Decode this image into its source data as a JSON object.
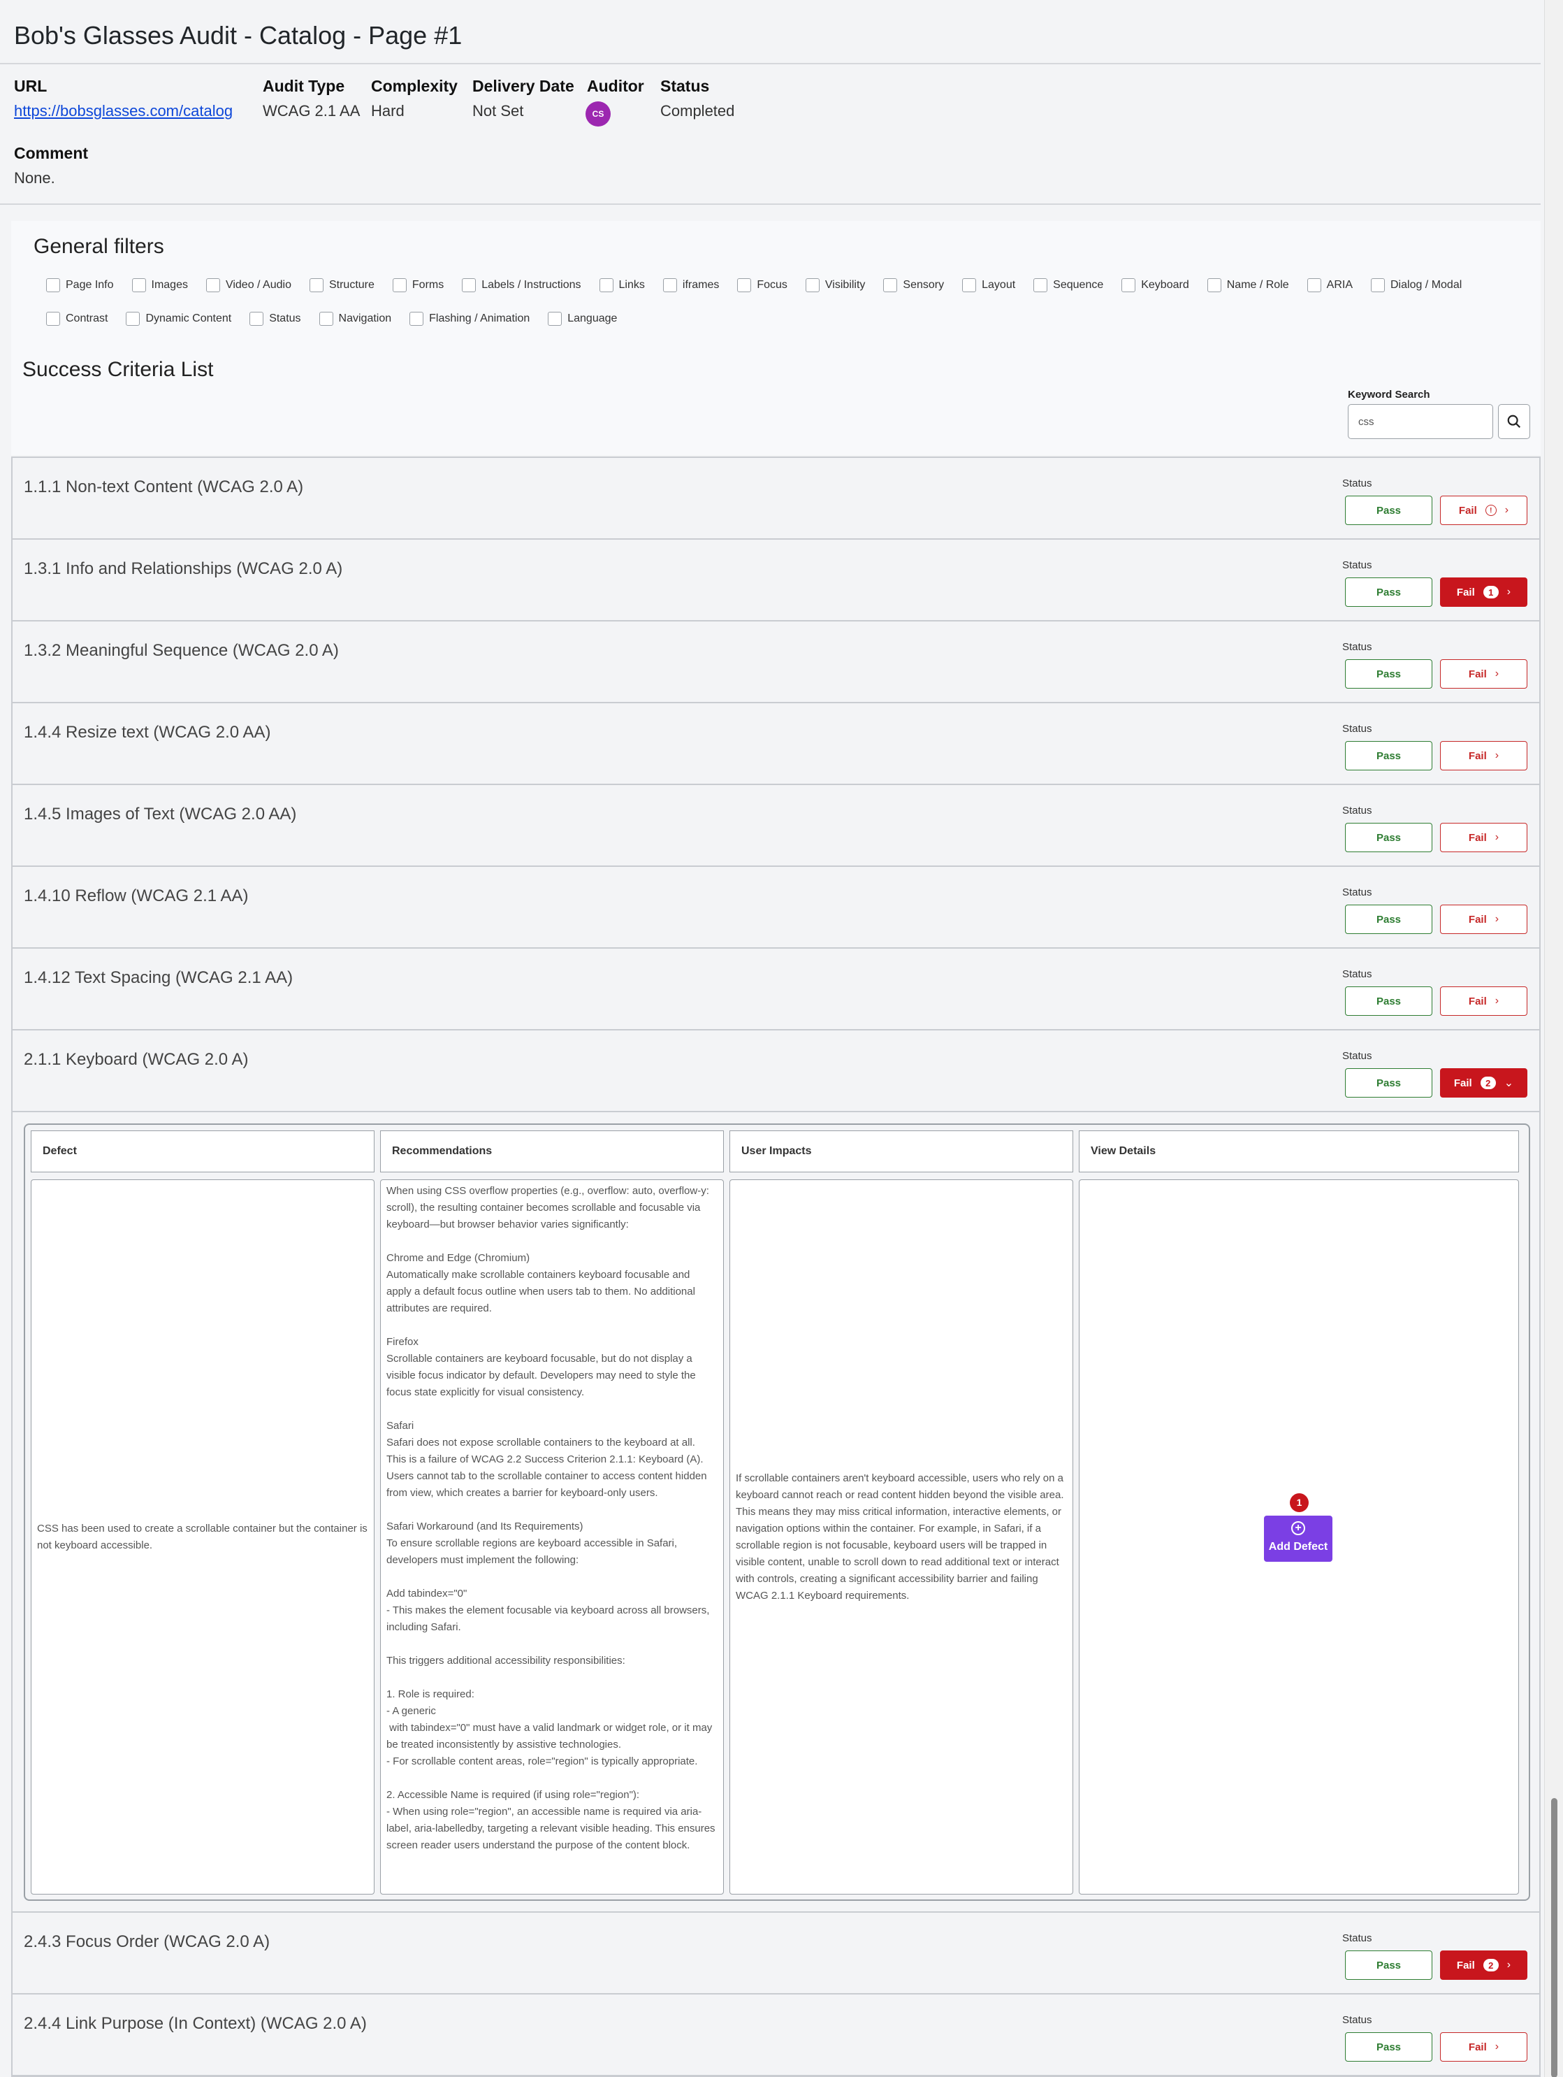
{
  "page_title": "Bob's Glasses Audit - Catalog - Page #1",
  "meta": {
    "url_label": "URL",
    "url_value": "https://bobsglasses.com/catalog",
    "audit_type_label": "Audit Type",
    "audit_type_value": "WCAG 2.1 AA",
    "complexity_label": "Complexity",
    "complexity_value": "Hard",
    "delivery_label": "Delivery Date",
    "delivery_value": "Not Set",
    "auditor_label": "Auditor",
    "auditor_initials": "CS",
    "status_label": "Status",
    "status_value": "Completed",
    "comment_label": "Comment",
    "comment_value": "None."
  },
  "filters": {
    "title": "General filters",
    "row1": [
      "Page Info",
      "Images",
      "Video / Audio",
      "Structure",
      "Forms",
      "Labels / Instructions",
      "Links",
      "iframes",
      "Focus",
      "Visibility",
      "Sensory",
      "Layout",
      "Sequence",
      "Keyboard",
      "Name / Role",
      "ARIA",
      "Dialog / Modal"
    ],
    "row2": [
      "Contrast",
      "Dynamic Content",
      "Status",
      "Navigation",
      "Flashing / Animation",
      "Language"
    ]
  },
  "success_list": {
    "title": "Success Criteria List",
    "keyword_label": "Keyword Search",
    "keyword_value": "css"
  },
  "criteria": [
    {
      "title": "1.1.1 Non-text Content (WCAG 2.0 A)",
      "status_label": "Status",
      "pass": "Pass",
      "fail": "Fail",
      "fail_state": "warning",
      "count": ""
    },
    {
      "title": "1.3.1 Info and Relationships (WCAG 2.0 A)",
      "status_label": "Status",
      "pass": "Pass",
      "fail": "Fail",
      "fail_state": "active",
      "count": "1"
    },
    {
      "title": "1.3.2 Meaningful Sequence (WCAG 2.0 A)",
      "status_label": "Status",
      "pass": "Pass",
      "fail": "Fail",
      "fail_state": "none",
      "count": ""
    },
    {
      "title": "1.4.4 Resize text (WCAG 2.0 AA)",
      "status_label": "Status",
      "pass": "Pass",
      "fail": "Fail",
      "fail_state": "none",
      "count": ""
    },
    {
      "title": "1.4.5 Images of Text (WCAG 2.0 AA)",
      "status_label": "Status",
      "pass": "Pass",
      "fail": "Fail",
      "fail_state": "none",
      "count": ""
    },
    {
      "title": "1.4.10 Reflow (WCAG 2.1 AA)",
      "status_label": "Status",
      "pass": "Pass",
      "fail": "Fail",
      "fail_state": "none",
      "count": ""
    },
    {
      "title": "1.4.12 Text Spacing (WCAG 2.1 AA)",
      "status_label": "Status",
      "pass": "Pass",
      "fail": "Fail",
      "fail_state": "none",
      "count": ""
    },
    {
      "title": "2.1.1 Keyboard (WCAG 2.0 A)",
      "status_label": "Status",
      "pass": "Pass",
      "fail": "Fail",
      "fail_state": "expanded",
      "count": "2"
    },
    {
      "title": "2.4.3 Focus Order (WCAG 2.0 A)",
      "status_label": "Status",
      "pass": "Pass",
      "fail": "Fail",
      "fail_state": "active",
      "count": "2"
    },
    {
      "title": "2.4.4 Link Purpose (In Context) (WCAG 2.0 A)",
      "status_label": "Status",
      "pass": "Pass",
      "fail": "Fail",
      "fail_state": "none",
      "count": ""
    }
  ],
  "defects_table": {
    "headers": {
      "defect": "Defect",
      "recommendations": "Recommendations",
      "user_impacts": "User Impacts",
      "view_details": "View Details"
    },
    "defect_text": "CSS has been used to create a scrollable container but the container is not keyboard accessible.",
    "recommendations_text": "When using CSS overflow properties (e.g., overflow: auto, overflow-y: scroll), the resulting container becomes scrollable and focusable via keyboard—but browser behavior varies significantly:\n\nChrome and Edge (Chromium)\nAutomatically make scrollable containers keyboard focusable and apply a default focus outline when users tab to them. No additional attributes are required.\n\nFirefox\nScrollable containers are keyboard focusable, but do not display a visible focus indicator by default. Developers may need to style the focus state explicitly for visual consistency.\n\nSafari\nSafari does not expose scrollable containers to the keyboard at all. This is a failure of WCAG 2.2 Success Criterion 2.1.1: Keyboard (A). Users cannot tab to the scrollable container to access content hidden from view, which creates a barrier for keyboard-only users.\n\nSafari Workaround (and Its Requirements)\nTo ensure scrollable regions are keyboard accessible in Safari, developers must implement the following:\n\nAdd tabindex=\"0\"\n- This makes the element focusable via keyboard across all browsers, including Safari.\n\nThis triggers additional accessibility responsibilities:\n\n1. Role is required:\n- A generic\n with tabindex=\"0\" must have a valid landmark or widget role, or it may be treated inconsistently by assistive technologies.\n- For scrollable content areas, role=\"region\" is typically appropriate.\n\n2. Accessible Name is required (if using role=\"region\"):\n- When using role=\"region\", an accessible name is required via aria-label, aria-labelledby, targeting a relevant visible heading. This ensures screen reader users understand the purpose of the content block.",
    "user_impacts_text": "If scrollable containers aren't keyboard accessible, users who rely on a keyboard cannot reach or read content hidden beyond the visible area. This means they may miss critical information, interactive elements, or navigation options within the container. For example, in Safari, if a scrollable region is not focusable, keyboard users will be trapped in visible content, unable to scroll down to read additional text or interact with controls, creating a significant accessibility barrier and failing WCAG 2.1.1 Keyboard requirements.",
    "add_defect_label": "Add Defect",
    "add_defect_count": "1"
  },
  "colors": {
    "pass": "#2e7d32",
    "fail": "#c62828",
    "fail_filled": "#c8161d",
    "add_defect": "#7b3fe4",
    "avatar": "#9c27b0",
    "link": "#0d47d9"
  },
  "icons": {
    "search": "search-icon",
    "chevron_right": "chevron-right-icon",
    "chevron_down": "chevron-down-icon",
    "warning": "warning-circle-icon",
    "plus": "plus-circle-icon"
  }
}
